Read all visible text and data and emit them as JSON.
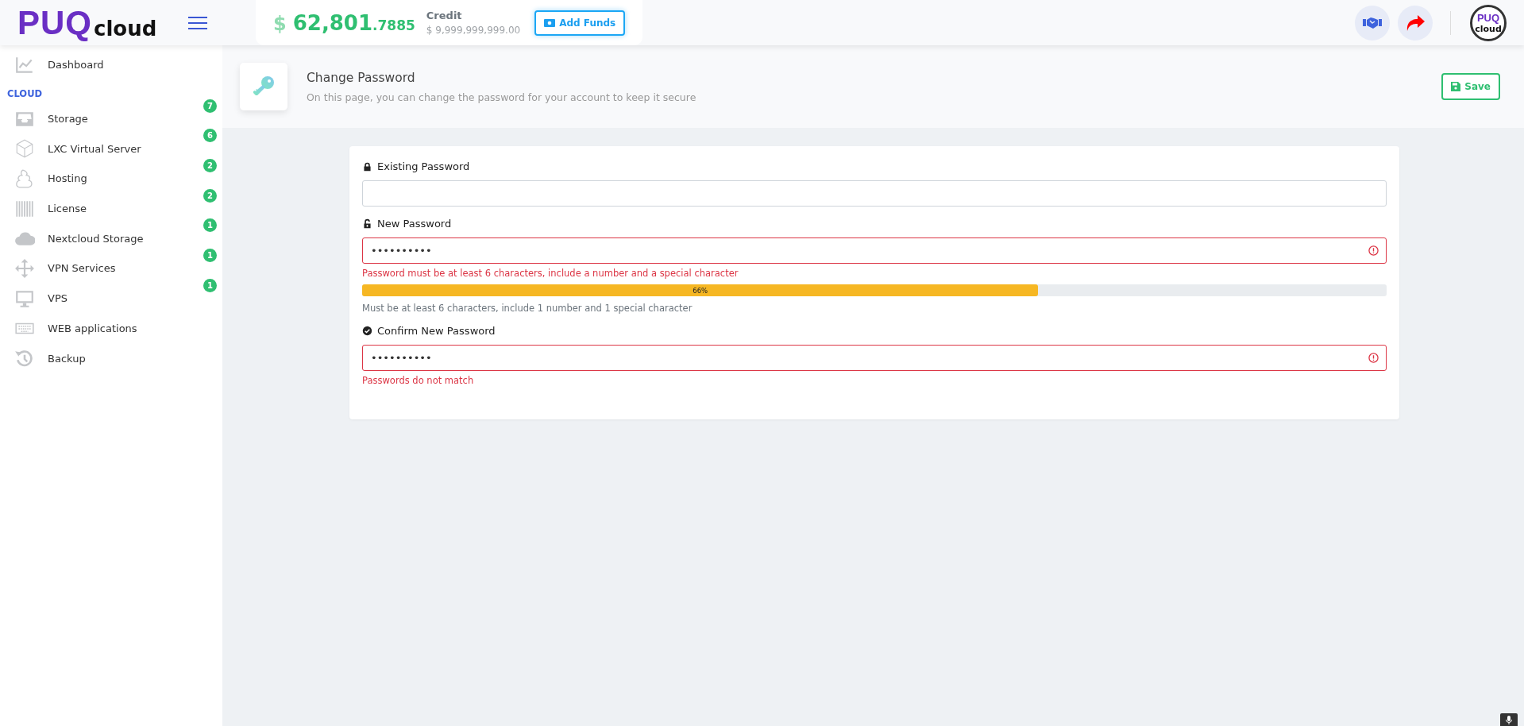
{
  "topbar": {
    "logo": {
      "mark": "PUQ",
      "word": "cloud"
    },
    "balance": {
      "currency": "$",
      "whole": "62,801",
      "fraction": ".7885"
    },
    "credit": {
      "label": "Credit",
      "amount": "$ 9,999,999,999.00"
    },
    "add_funds": "Add Funds",
    "avatar": {
      "mark": "PUQ",
      "word": "cloud"
    }
  },
  "sidebar": {
    "items": [
      {
        "label": "Dashboard"
      }
    ],
    "section": "CLOUD",
    "cloud_items": [
      {
        "label": "Storage",
        "badge": "7"
      },
      {
        "label": "LXC Virtual Server",
        "badge": "6"
      },
      {
        "label": "Hosting",
        "badge": "2"
      },
      {
        "label": "License",
        "badge": "2"
      },
      {
        "label": "Nextcloud Storage",
        "badge": "1"
      },
      {
        "label": "VPN Services",
        "badge": "1"
      },
      {
        "label": "VPS",
        "badge": "1"
      },
      {
        "label": "WEB applications"
      },
      {
        "label": "Backup"
      }
    ]
  },
  "header": {
    "title": "Change Password",
    "subtitle": "On this page, you can change the password for your account to keep it secure",
    "save": "Save"
  },
  "form": {
    "fields": [
      {
        "label": "Existing Password",
        "invalid": false
      },
      {
        "label": "New Password",
        "value": "••••••••••",
        "invalid": true,
        "error": "Password must be at least 6 characters, include a number and a special character",
        "strength": {
          "level": 0.66,
          "label": "66%"
        },
        "hint": "Must be at least 6 characters, include 1 number and 1 special character"
      },
      {
        "label": "Confirm New Password",
        "value": "••••••••••",
        "invalid": true,
        "error": "Passwords do not match"
      }
    ]
  }
}
